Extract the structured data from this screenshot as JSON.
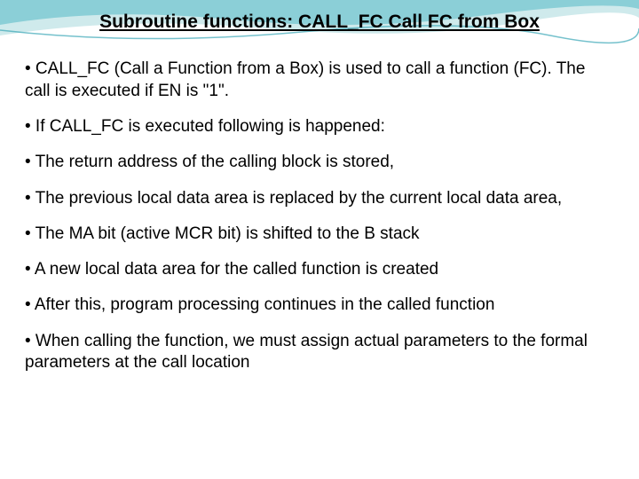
{
  "slide": {
    "title": "Subroutine functions: CALL_FC Call FC from Box",
    "bullets": [
      "• CALL_FC (Call a Function from a Box) is used to call a function (FC).  The call is executed if EN is \"1\".",
      "• If CALL_FC is executed following is happened:",
      "• The return address of the calling block is stored,",
      "• The previous local data area is replaced by the current local data area,",
      "• The MA bit (active MCR bit) is shifted to the B stack",
      "• A new local data area for the called function is created",
      "• After this, program processing continues in the called function",
      "• When calling the function, we must assign actual parameters to the formal parameters at the call location"
    ]
  },
  "theme": {
    "wave_top_color": "#4db8c8",
    "wave_bottom_color": "#a8d8dc"
  }
}
